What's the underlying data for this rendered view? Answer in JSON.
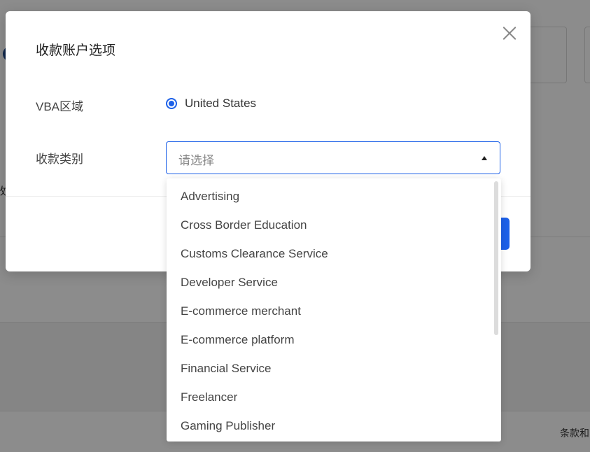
{
  "modal": {
    "title": "收款账户选项",
    "vba_label": "VBA区域",
    "vba_option": "United States",
    "type_label": "收款类别",
    "select_placeholder": "请选择"
  },
  "dropdown": {
    "options": [
      "Advertising",
      "Cross Border Education",
      "Customs Clearance Service",
      "Developer Service",
      "E-commerce merchant",
      "E-commerce platform",
      "Financial Service",
      "Freelancer",
      "Gaming Publisher"
    ]
  },
  "background": {
    "footer_text": "条款和",
    "left_glyph": "收"
  },
  "icons": {
    "close": "close-icon",
    "dropdown_arrow": "caret-up-icon"
  },
  "colors": {
    "accent": "#1c60e8",
    "overlay": "rgba(0,0,0,0.45)"
  }
}
